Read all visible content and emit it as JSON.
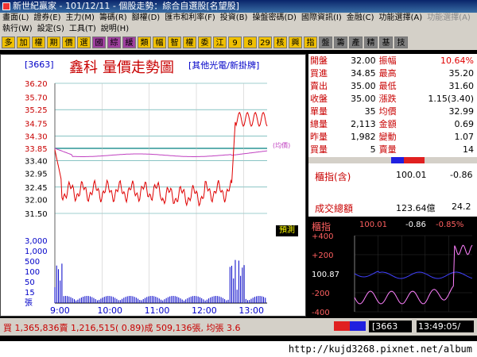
{
  "window": {
    "title": "新世紀贏家 - 101/12/11 - 個股走勢：綜合自選股[名望股]"
  },
  "menu_row1": [
    "畫面(L)",
    "證券(E)",
    "主力(M)",
    "籌碼(R)",
    "腳權(D)",
    "匯市和利率(F)",
    "投資(B)",
    "操盤密碼(D)",
    "國際資訊(I)",
    "金融(C)",
    "功能選擇(A)",
    "功能選擇(A)"
  ],
  "menu_row2": [
    "執行(W)",
    "設定(S)",
    "工具(T)",
    "說明(H)"
  ],
  "toolbar": {
    "buttons": [
      {
        "label": "多",
        "color": "#f0c000"
      },
      {
        "label": "加",
        "color": "#f0c000"
      },
      {
        "label": "權",
        "color": "#f0c000"
      },
      {
        "label": "期",
        "color": "#f0c000"
      },
      {
        "label": "價",
        "color": "#f0c000"
      },
      {
        "label": "選",
        "color": "#f0c000"
      },
      {
        "label": "國",
        "color": "#a040a0"
      },
      {
        "label": "綜",
        "color": "#a040a0"
      },
      {
        "label": "緩",
        "color": "#a040a0"
      },
      {
        "label": "類",
        "color": "#f0c000"
      },
      {
        "label": "幅",
        "color": "#f0c000"
      },
      {
        "label": "智",
        "color": "#f0c000"
      },
      {
        "label": "權",
        "color": "#f0c000"
      },
      {
        "label": "委",
        "color": "#f0c000"
      },
      {
        "label": "江",
        "color": "#f0c000"
      },
      {
        "label": "9",
        "color": "#f0c000"
      },
      {
        "label": "8",
        "color": "#f0c000"
      },
      {
        "label": "29",
        "color": "#f0c000"
      },
      {
        "label": "核",
        "color": "#f0c000"
      },
      {
        "label": "興",
        "color": "#f0c000"
      },
      {
        "label": "指",
        "color": "#f0c000"
      },
      {
        "label": "盤",
        "color": "#808080"
      },
      {
        "label": "籌",
        "color": "#808080"
      },
      {
        "label": "產",
        "color": "#808080"
      },
      {
        "label": "精",
        "color": "#808080"
      },
      {
        "label": "基",
        "color": "#808080"
      },
      {
        "label": "技",
        "color": "#808080"
      }
    ]
  },
  "stock": {
    "code": "[3663]",
    "name": "鑫科",
    "chart_title": "量價走勢圖",
    "category": "[其他光電/新掛牌]",
    "avg_label": "(均價)"
  },
  "quote": [
    {
      "l1": "開盤",
      "v1": "32.00",
      "l2": "振幅",
      "v2": "10.64%",
      "c1": "#000",
      "c2": "#e00000"
    },
    {
      "l1": "買進",
      "v1": "34.85",
      "l2": "最高",
      "v2": "35.20",
      "c1": "#000",
      "c2": "#000"
    },
    {
      "l1": "賣出",
      "v1": "35.00",
      "l2": "最低",
      "v2": "31.60",
      "c1": "#000",
      "c2": "#000"
    },
    {
      "l1": "收盤",
      "v1": "35.00",
      "l2": "漲跌",
      "v2": "1.15(3.40)",
      "c1": "#000",
      "c2": "#000"
    },
    {
      "l1": "單量",
      "v1": "35",
      "l2": "均價",
      "v2": "32.99",
      "c1": "#000",
      "c2": "#000"
    },
    {
      "l1": "總量",
      "v1": "2,113",
      "l2": "金額",
      "v2": "0.69",
      "c1": "#000",
      "c2": "#000"
    },
    {
      "l1": "昨量",
      "v1": "1,982",
      "l2": "變動",
      "v2": "1.07",
      "c1": "#000",
      "c2": "#000"
    },
    {
      "l1": "買量",
      "v1": "5",
      "l2": "賣量",
      "v2": "14",
      "c1": "#000",
      "c2": "#000"
    }
  ],
  "index_info": {
    "label": "櫃指(含)",
    "value": "100.01",
    "change": "-0.86",
    "volume_label": "成交總額",
    "volume_value": "123.64億",
    "volume_change": "24.2"
  },
  "mini_index": {
    "label": "櫃指",
    "value": "100.01",
    "change": "-0.86",
    "pct": "-0.85%",
    "yticks": [
      "+400",
      "+200",
      "100.87",
      "-200",
      "-400"
    ]
  },
  "forecast_button": "預測",
  "chart_data": {
    "type": "line",
    "price_ticks": [
      "36.20",
      "35.70",
      "35.25",
      "34.75",
      "34.30",
      "33.85",
      "33.40",
      "32.95",
      "32.45",
      "32.00",
      "31.50"
    ],
    "volume_ticks": [
      "3,000",
      "1,000",
      "500",
      "100",
      "50",
      "15",
      "張"
    ],
    "time_ticks": [
      "9:00",
      "10:00",
      "11:00",
      "12:00",
      "13:00"
    ],
    "ylim": [
      31.5,
      36.2
    ],
    "reference_price": 33.85,
    "series": []
  },
  "status": {
    "text": "買 1,365,836賣 1,216,515( 0.89)成 509,136張, 均張 3.6",
    "code": "[3663",
    "time": "13:49:05/"
  },
  "url": "http://kujd3268.pixnet.net/album"
}
